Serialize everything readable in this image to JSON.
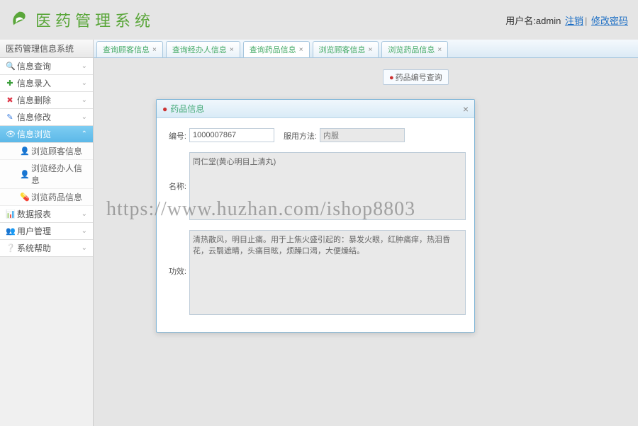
{
  "header": {
    "title": "医药管理系统",
    "user_label": "用户名:",
    "user_name": "admin",
    "logout": "注销",
    "change_pw": "修改密码"
  },
  "sidebar": {
    "title": "医药管理信息系统",
    "groups": [
      {
        "label": "信息查询",
        "icon": "search",
        "expanded": false
      },
      {
        "label": "信息录入",
        "icon": "plus",
        "expanded": false
      },
      {
        "label": "信息删除",
        "icon": "delete",
        "expanded": false
      },
      {
        "label": "信息修改",
        "icon": "edit",
        "expanded": false
      },
      {
        "label": "信息浏览",
        "icon": "eye",
        "expanded": true,
        "active": true,
        "items": [
          {
            "label": "浏览顾客信息",
            "icon": "user"
          },
          {
            "label": "浏览经办人信息",
            "icon": "user"
          },
          {
            "label": "浏览药品信息",
            "icon": "pill"
          }
        ]
      },
      {
        "label": "数据报表",
        "icon": "report",
        "expanded": false
      },
      {
        "label": "用户管理",
        "icon": "user",
        "expanded": false
      },
      {
        "label": "系统帮助",
        "icon": "help",
        "expanded": false
      }
    ]
  },
  "tabs": [
    {
      "label": "查询顾客信息",
      "active": false
    },
    {
      "label": "查询经办人信息",
      "active": false
    },
    {
      "label": "查询药品信息",
      "active": true
    },
    {
      "label": "浏览顾客信息",
      "active": false
    },
    {
      "label": "浏览药品信息",
      "active": false
    }
  ],
  "bg_panel_title": "药品编号查询",
  "modal": {
    "title": "药品信息",
    "fields": {
      "id_label": "编号:",
      "id_value": "1000007867",
      "usage_label": "服用方法:",
      "usage_value": "内服",
      "name_label": "名称:",
      "name_value": "同仁堂(黄心明目上清丸)",
      "effect_label": "功效:",
      "effect_value": "清热散风，明目止痛。用于上焦火盛引起的：暴发火眼，红肿痛痒，热泪昏花，云翳遮睛，头痛目眩，烦躁口渴，大便燥结。"
    }
  },
  "watermark": "https://www.huzhan.com/ishop8803"
}
